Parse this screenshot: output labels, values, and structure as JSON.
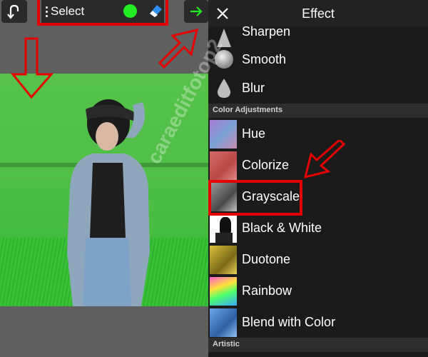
{
  "toolbar": {
    "select_label": "Select",
    "brush_color": "#22ee22",
    "eraser_color": "#2f8ff0"
  },
  "panel": {
    "title": "Effect",
    "sections": {
      "color_adjustments": "Color Adjustments",
      "artistic": "Artistic"
    },
    "items": [
      {
        "label": "Sharpen",
        "icon": "sharpen-icon"
      },
      {
        "label": "Smooth",
        "icon": "smooth-icon"
      },
      {
        "label": "Blur",
        "icon": "blur-icon"
      },
      {
        "label": "Hue"
      },
      {
        "label": "Colorize"
      },
      {
        "label": "Grayscale"
      },
      {
        "label": "Black & White"
      },
      {
        "label": "Duotone"
      },
      {
        "label": "Rainbow"
      },
      {
        "label": "Blend with Color"
      }
    ]
  },
  "watermark": "caraeditfotop2",
  "colors": {
    "accent_red": "#e50000",
    "next_arrow": "#22ee22",
    "panel_bg": "#1b1b1b"
  }
}
